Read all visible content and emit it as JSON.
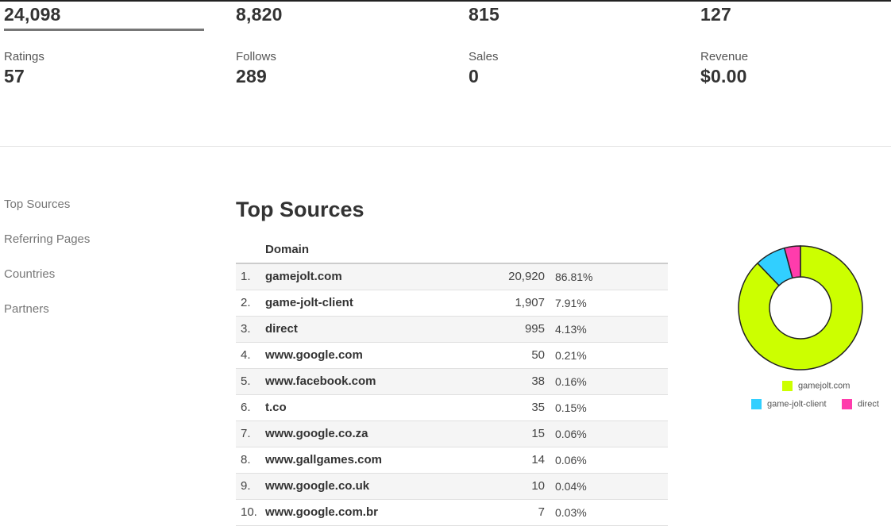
{
  "stats": [
    {
      "label": "",
      "value": "24,098"
    },
    {
      "label": "",
      "value": "8,820"
    },
    {
      "label": "",
      "value": "815"
    },
    {
      "label": "",
      "value": "127"
    },
    {
      "label": "Ratings",
      "value": "57"
    },
    {
      "label": "Follows",
      "value": "289"
    },
    {
      "label": "Sales",
      "value": "0"
    },
    {
      "label": "Revenue",
      "value": "$0.00"
    }
  ],
  "nav": {
    "items": [
      {
        "label": "Top Sources"
      },
      {
        "label": "Referring Pages"
      },
      {
        "label": "Countries"
      },
      {
        "label": "Partners"
      }
    ]
  },
  "section": {
    "title": "Top Sources"
  },
  "table": {
    "header": {
      "domain": "Domain"
    },
    "rows": [
      {
        "index": "1.",
        "domain": "gamejolt.com",
        "count": "20,920",
        "percent": "86.81%"
      },
      {
        "index": "2.",
        "domain": "game-jolt-client",
        "count": "1,907",
        "percent": "7.91%"
      },
      {
        "index": "3.",
        "domain": "direct",
        "count": "995",
        "percent": "4.13%"
      },
      {
        "index": "4.",
        "domain": "www.google.com",
        "count": "50",
        "percent": "0.21%"
      },
      {
        "index": "5.",
        "domain": "www.facebook.com",
        "count": "38",
        "percent": "0.16%"
      },
      {
        "index": "6.",
        "domain": "t.co",
        "count": "35",
        "percent": "0.15%"
      },
      {
        "index": "7.",
        "domain": "www.google.co.za",
        "count": "15",
        "percent": "0.06%"
      },
      {
        "index": "8.",
        "domain": "www.gallgames.com",
        "count": "14",
        "percent": "0.06%"
      },
      {
        "index": "9.",
        "domain": "www.google.co.uk",
        "count": "10",
        "percent": "0.04%"
      },
      {
        "index": "10.",
        "domain": "www.google.com.br",
        "count": "7",
        "percent": "0.03%"
      }
    ]
  },
  "chart_data": {
    "type": "pie",
    "donut": true,
    "categories": [
      "gamejolt.com",
      "game-jolt-client",
      "direct"
    ],
    "values": [
      20920,
      1907,
      995
    ],
    "colors": [
      "#ccff00",
      "#31cfff",
      "#ff3cac"
    ],
    "legend": "bottom"
  }
}
